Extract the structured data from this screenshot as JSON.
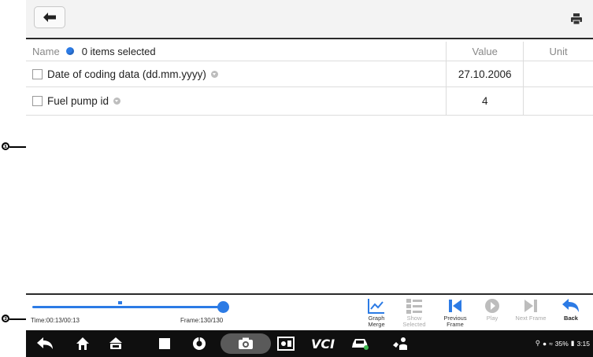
{
  "callouts": [
    "❶",
    "❷"
  ],
  "table": {
    "header": {
      "name": "Name",
      "selection": "0 items selected",
      "value": "Value",
      "unit": "Unit"
    },
    "rows": [
      {
        "name": "Date of coding data (dd.mm.yyyy)",
        "value": "27.10.2006",
        "unit": ""
      },
      {
        "name": "Fuel pump id",
        "value": "4",
        "unit": ""
      }
    ]
  },
  "playback": {
    "time": "Time:00:13/00:13",
    "frame": "Frame:130/130",
    "progress": 1.0
  },
  "controls": {
    "graph_merge": "Graph\nMerge",
    "show_selected": "Show\nSelected",
    "previous_frame": "Previous\nFrame",
    "play": "Play",
    "next_frame": "Next Frame",
    "back": "Back"
  },
  "navbar": {
    "vci_label": "VCI",
    "status_text": "35%",
    "clock": "3:15"
  },
  "colors": {
    "accent": "#2c7be5",
    "navbar": "#0f0f0f",
    "topbar": "#f3f3f3"
  }
}
